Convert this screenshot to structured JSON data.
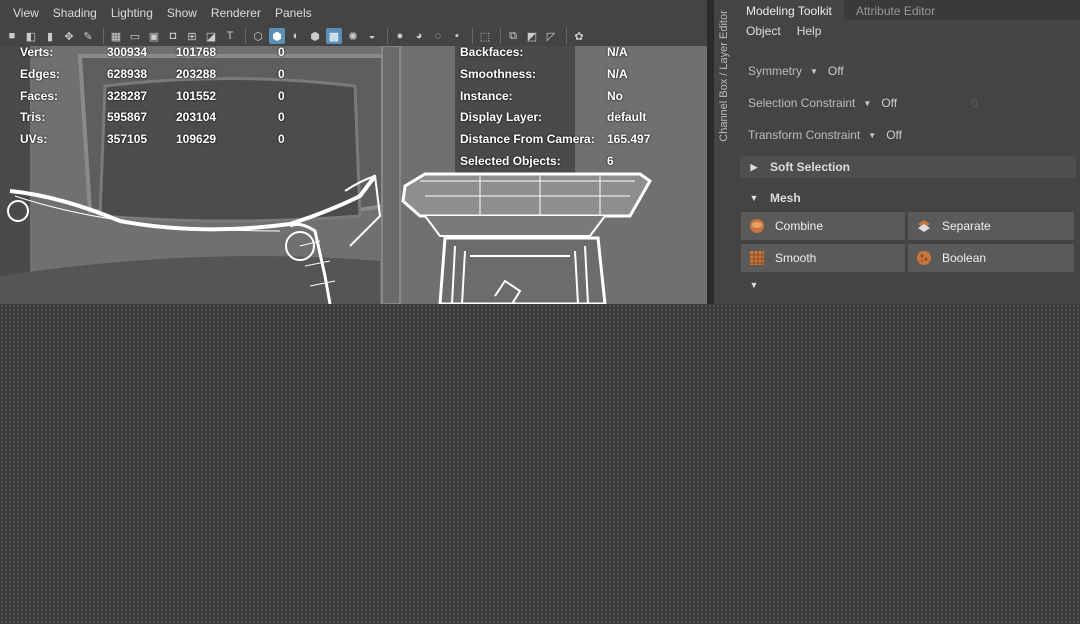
{
  "viewport": {
    "menus": [
      "View",
      "Shading",
      "Lighting",
      "Show",
      "Renderer",
      "Panels"
    ],
    "hud_left": [
      {
        "label": "Verts:",
        "values": [
          "300934",
          "101768",
          "0"
        ]
      },
      {
        "label": "Edges:",
        "values": [
          "628938",
          "203288",
          "0"
        ]
      },
      {
        "label": "Faces:",
        "values": [
          "328287",
          "101552",
          "0"
        ]
      },
      {
        "label": "Tris:",
        "values": [
          "595867",
          "203104",
          "0"
        ]
      },
      {
        "label": "UVs:",
        "values": [
          "357105",
          "109629",
          "0"
        ]
      }
    ],
    "hud_right": [
      {
        "label": "Backfaces:",
        "value": "N/A"
      },
      {
        "label": "Smoothness:",
        "value": "N/A"
      },
      {
        "label": "Instance:",
        "value": "No"
      },
      {
        "label": "Display Layer:",
        "value": "default"
      },
      {
        "label": "Distance From Camera:",
        "value": "165.497"
      },
      {
        "label": "Selected Objects:",
        "value": "6"
      }
    ]
  },
  "side_strip_label": "Channel Box / Layer Editor",
  "panel": {
    "tabs": [
      "Modeling Toolkit",
      "Attribute Editor"
    ],
    "menu": [
      "Object",
      "Help"
    ],
    "symmetry_label": "Symmetry",
    "symmetry_value": "Off",
    "selection_constraint_label": "Selection Constraint",
    "selection_constraint_value": "Off",
    "selection_constraint_extra": "0",
    "transform_constraint_label": "Transform Constraint",
    "transform_constraint_value": "Off",
    "soft_selection_label": "Soft Selection",
    "mesh_label": "Mesh",
    "buttons": {
      "combine": "Combine",
      "separate": "Separate",
      "smooth": "Smooth",
      "boolean": "Boolean"
    }
  },
  "colors": {
    "accent": "#5a8fb8",
    "panel_bg": "#444444",
    "viewport_bg": "#6e6e6e"
  }
}
